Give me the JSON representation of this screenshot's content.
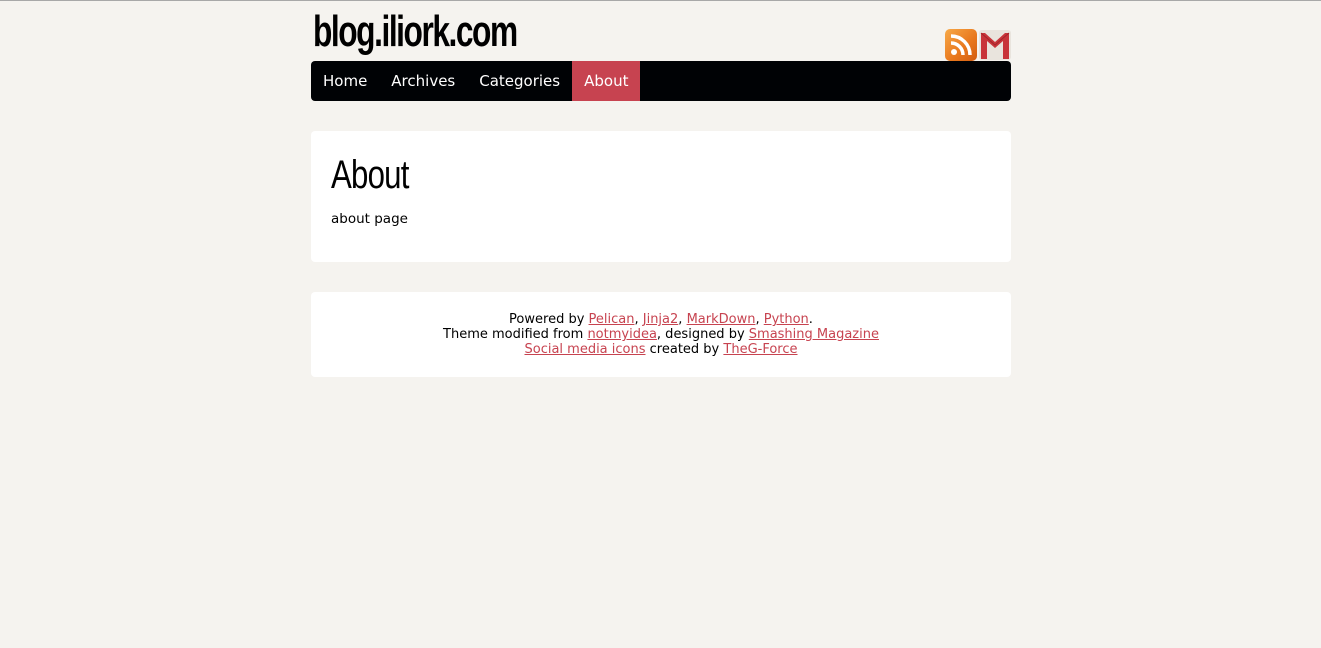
{
  "site": {
    "title": "blog.iliork.com"
  },
  "social": {
    "rss_icon": "rss-icon",
    "gmail_icon": "gmail-icon"
  },
  "nav": {
    "items": [
      {
        "label": "Home",
        "active": false
      },
      {
        "label": "Archives",
        "active": false
      },
      {
        "label": "Categories",
        "active": false
      },
      {
        "label": "About",
        "active": true
      }
    ]
  },
  "content": {
    "heading": "About",
    "body": "about page"
  },
  "footer": {
    "line1": {
      "prefix": "Powered by ",
      "links": [
        "Pelican",
        "Jinja2",
        "MarkDown",
        "Python"
      ],
      "sep": ", ",
      "suffix": "."
    },
    "line2": {
      "prefix": "Theme modified from ",
      "link1": "notmyidea",
      "middle": ", designed by ",
      "link2": "Smashing Magazine"
    },
    "line3": {
      "link1": "Social media icons",
      "middle": " created by ",
      "link2": "TheG-Force"
    }
  },
  "colors": {
    "background": "#f5f3ef",
    "nav_bg": "#000205",
    "accent": "#c74350"
  }
}
